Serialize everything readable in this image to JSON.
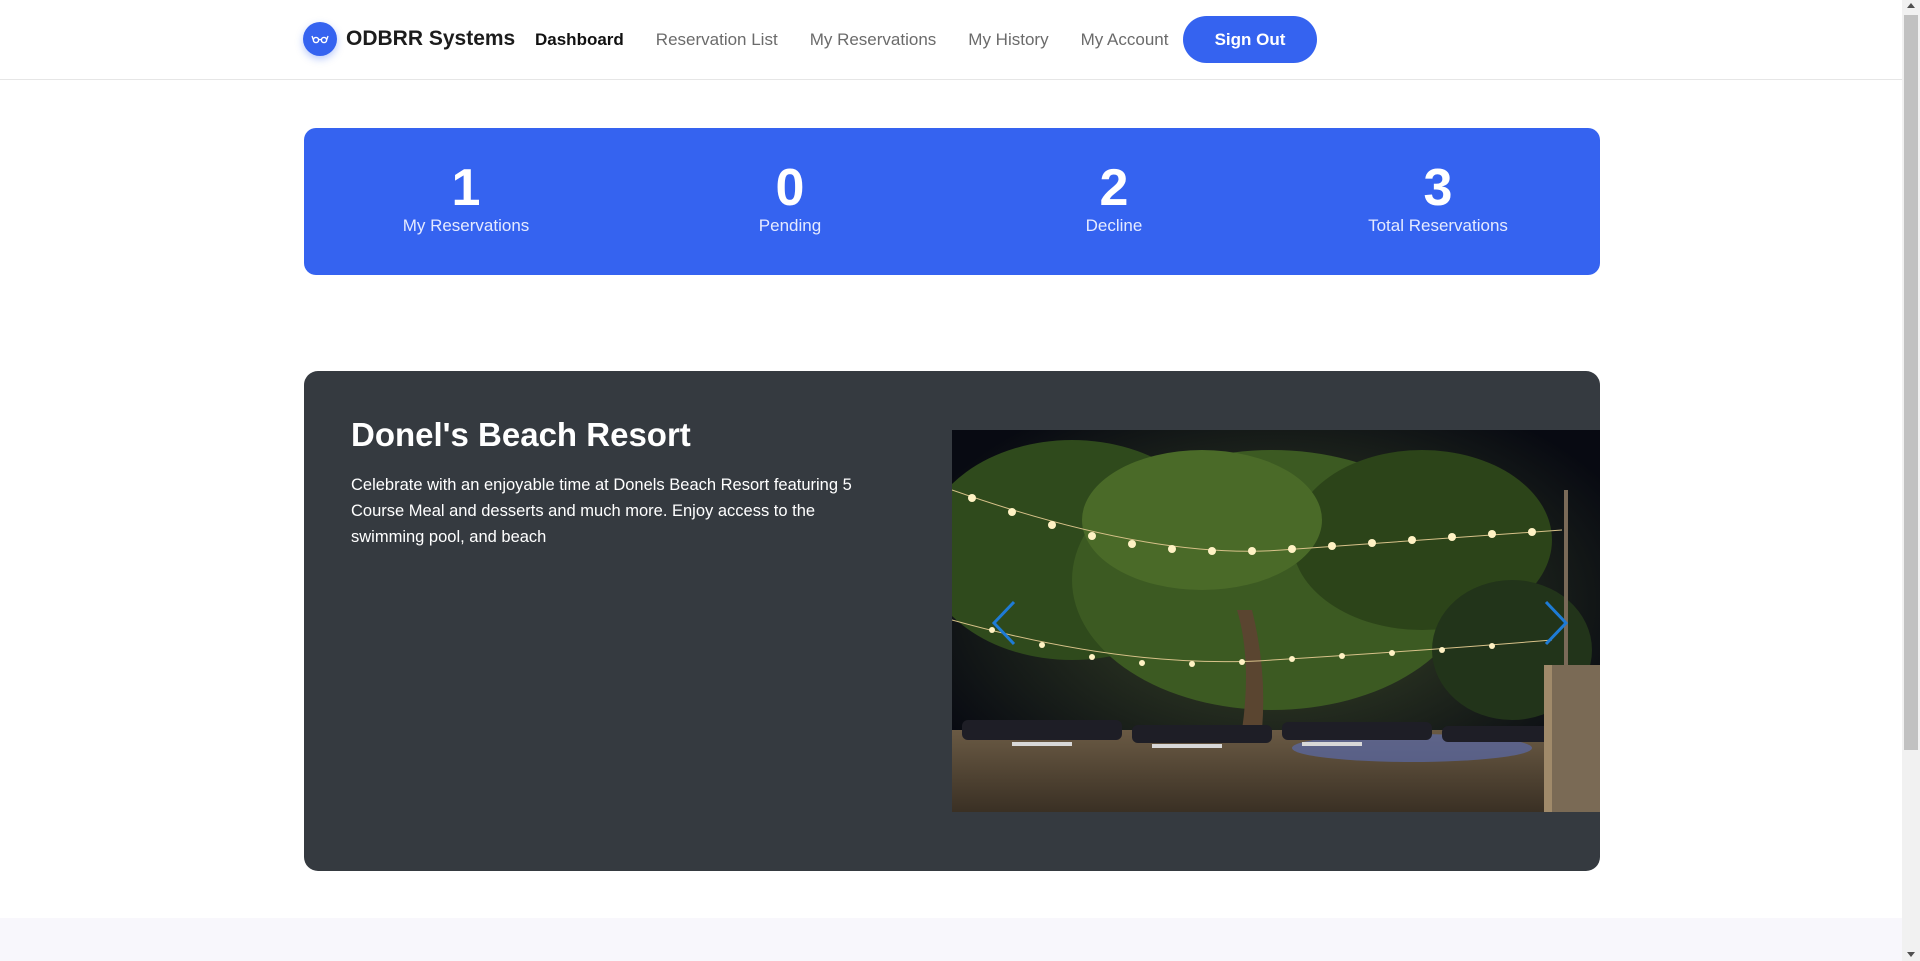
{
  "brand": {
    "name": "ODBRR Systems",
    "logo_icon": "glasses-icon",
    "accent": "#3563f0"
  },
  "nav": {
    "items": [
      {
        "label": "Dashboard",
        "active": true
      },
      {
        "label": "Reservation List",
        "active": false
      },
      {
        "label": "My Reservations",
        "active": false
      },
      {
        "label": "My History",
        "active": false
      },
      {
        "label": "My Account",
        "active": false
      }
    ],
    "signout_label": "Sign Out"
  },
  "stats": [
    {
      "value": "1",
      "label": "My Reservations"
    },
    {
      "value": "0",
      "label": "Pending"
    },
    {
      "value": "2",
      "label": "Decline"
    },
    {
      "value": "3",
      "label": "Total Reservations"
    }
  ],
  "resort": {
    "title": "Donel's Beach Resort",
    "description": "Celebrate with an enjoyable time at Donels Beach Resort featuring 5 Course Meal and desserts and much more. Enjoy access to the swimming pool, and beach",
    "carousel": {
      "prev_icon": "chevron-left-icon",
      "next_icon": "chevron-right-icon",
      "arrow_color": "#1e7bd6"
    }
  }
}
